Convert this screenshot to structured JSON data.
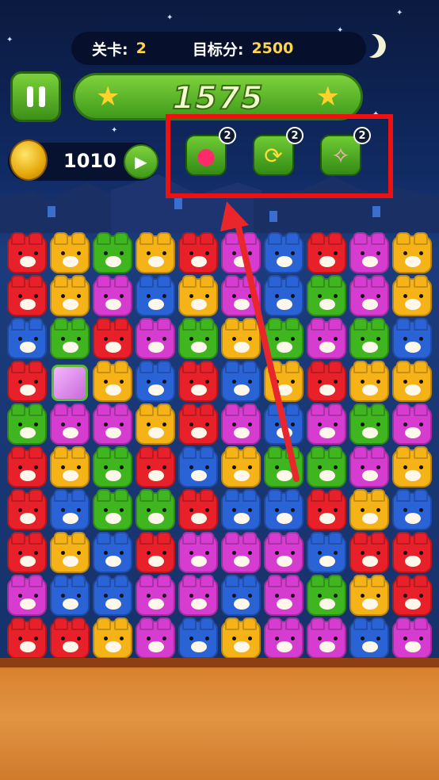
{
  "header": {
    "level_label": "关卡:",
    "level_value": "2",
    "target_label": "目标分:",
    "target_value": "2500"
  },
  "score": "1575",
  "coins": "1010",
  "tools": [
    {
      "name": "candy-bomb",
      "count": "2"
    },
    {
      "name": "shuffle",
      "count": "2"
    },
    {
      "name": "broom",
      "count": "2"
    }
  ],
  "colors": {
    "R": "#e8202a",
    "Y": "#f5b318",
    "G": "#3fb520",
    "B": "#2a63d6",
    "P": "#d63cd0",
    "gift": "#f0a8ff"
  },
  "board": [
    "RYGYRPBRPY",
    "RYPBYPBGPY",
    "BGRPGYGPGB",
    "R*YBRBYRYY",
    "GPPYRPBPGP",
    "RYGRBYGGPY",
    "RBGGRBBRYB",
    "RYBRPPPBRR",
    "PBBPPBPGYR",
    "RRYPBYPPBP"
  ]
}
